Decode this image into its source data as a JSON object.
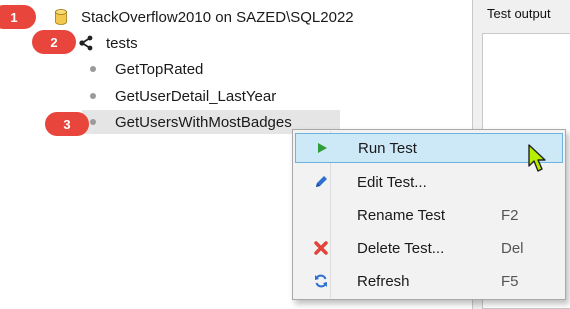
{
  "tree": {
    "root": {
      "label": "StackOverflow2010 on SAZED\\SQL2022",
      "icon": "database-icon"
    },
    "schema": {
      "label": "tests",
      "icon": "share-icon"
    },
    "items": [
      {
        "label": "GetTopRated"
      },
      {
        "label": "GetUserDetail_LastYear"
      },
      {
        "label": "GetUsersWithMostBadges",
        "selected": true
      }
    ]
  },
  "output_panel": {
    "title": "Test output"
  },
  "annotations": [
    "1",
    "2",
    "3"
  ],
  "context_menu": {
    "items": [
      {
        "label": "Run Test",
        "shortcut": "",
        "icon": "play-icon",
        "highlighted": true
      },
      {
        "label": "Edit Test...",
        "shortcut": "",
        "icon": "pencil-icon"
      },
      {
        "label": "Rename Test",
        "shortcut": "F2",
        "icon": ""
      },
      {
        "label": "Delete Test...",
        "shortcut": "Del",
        "icon": "delete-x-icon"
      },
      {
        "label": "Refresh",
        "shortcut": "F5",
        "icon": "refresh-icon"
      }
    ]
  },
  "colors": {
    "badge": "#e8463d",
    "highlight": "#cde8f6",
    "play": "#2e9e3a",
    "pencil": "#2f6fd1",
    "delete": "#e0443a",
    "refresh": "#2f6fd1",
    "cursor": "#b6f000"
  }
}
